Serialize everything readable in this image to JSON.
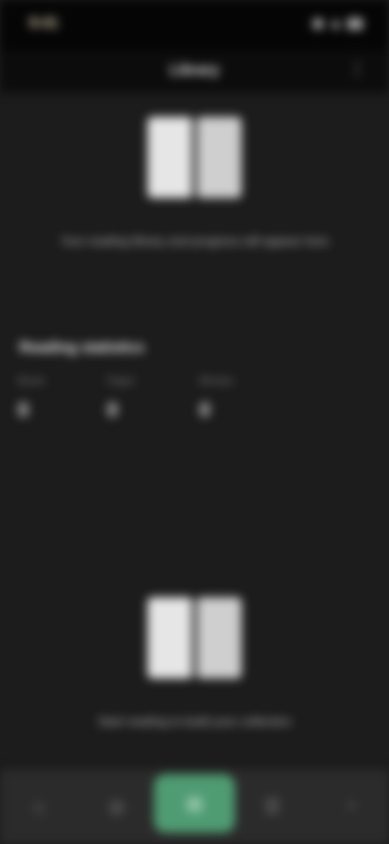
{
  "status_bar": {
    "time": "9:41",
    "icons": "◉ ▲ ▮▮"
  },
  "header": {
    "title": "Library",
    "overflow_icon": "⋮"
  },
  "top_book": {
    "caption": "Your reading library and progress will appear here"
  },
  "section": {
    "title": "Reading statistics",
    "stats": [
      {
        "label": "Books",
        "value": "0"
      },
      {
        "label": "Pages",
        "value": "0"
      },
      {
        "label": "Minutes",
        "value": "0"
      }
    ]
  },
  "bottom_book": {
    "caption": "Start reading to build your collection"
  },
  "bottom_nav": {
    "items": [
      {
        "label": "⌂"
      },
      {
        "label": "◎"
      },
      {
        "label": "▤"
      },
      {
        "label": "☰"
      },
      {
        "label": "◔"
      }
    ],
    "active_index": 2,
    "accent_color": "#4f9b72"
  }
}
